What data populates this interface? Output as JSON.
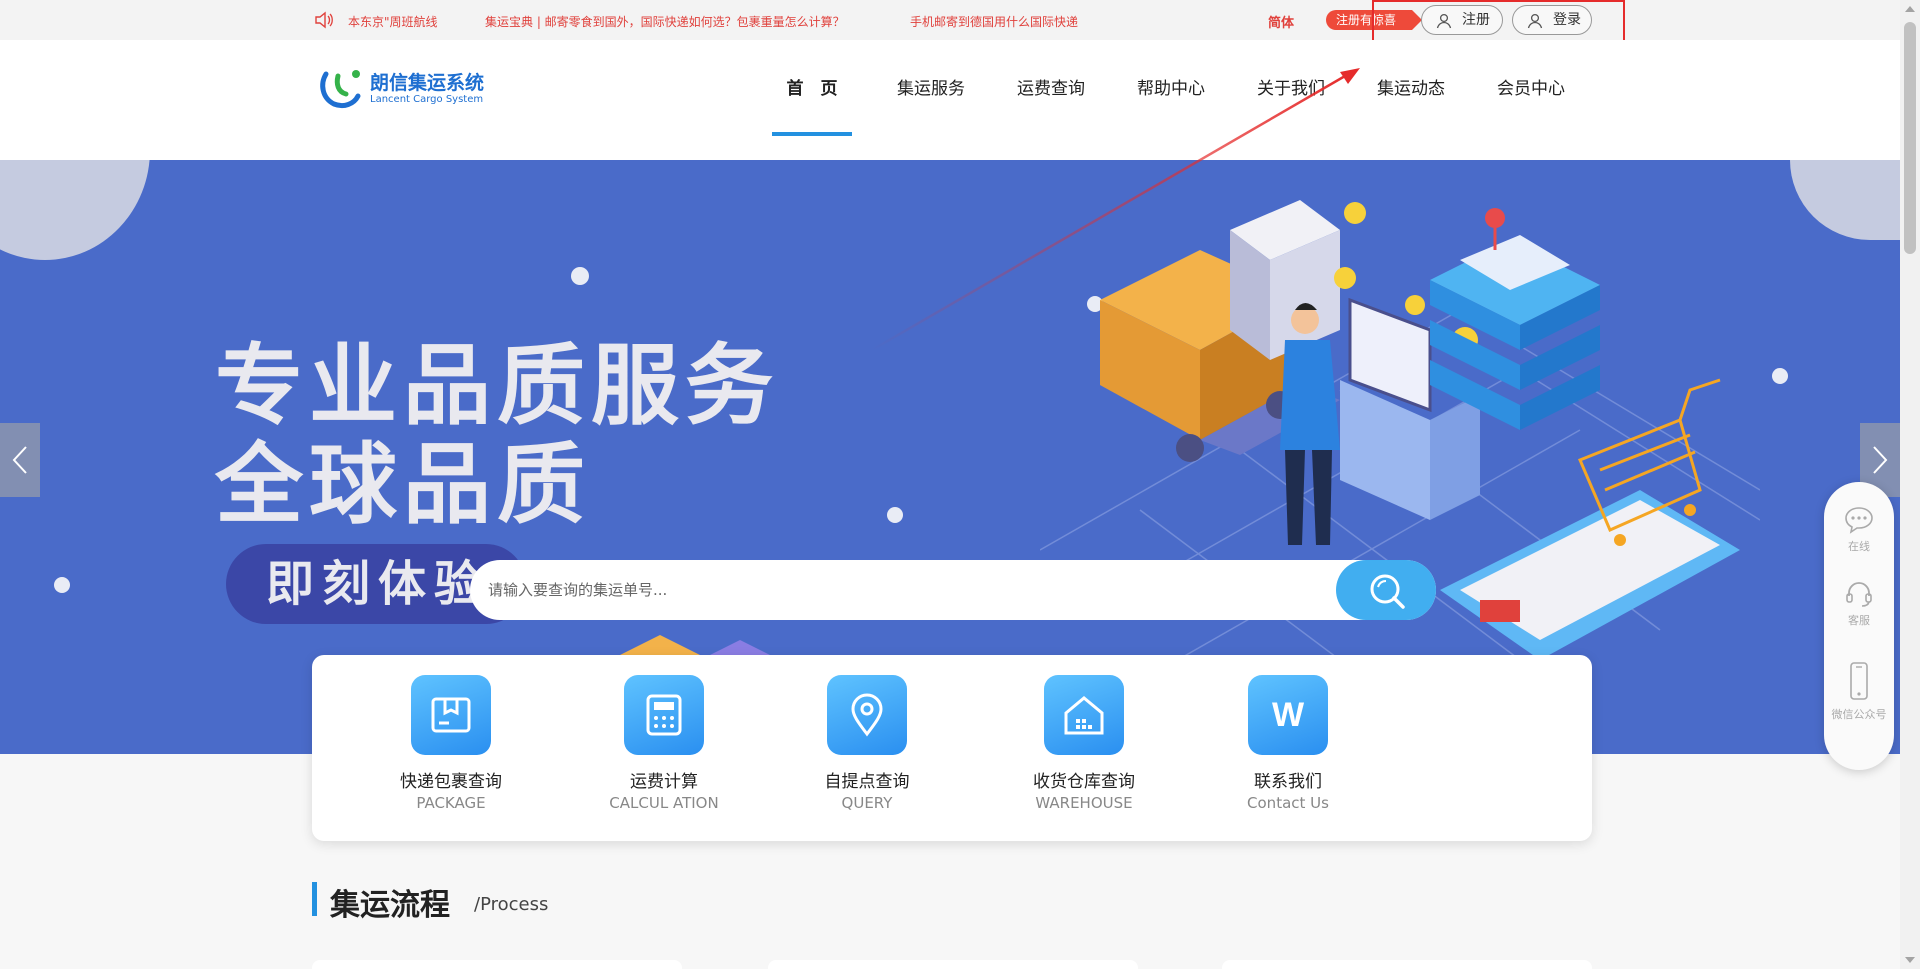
{
  "topbar": {
    "notices": [
      "本东京\"周班航线",
      "集运宝典 | 邮寄零食到国外，国际快递如何选？包裹重量怎么计算？",
      "手机邮寄到德国用什么国际快递"
    ],
    "language": "简体",
    "promo": "注册有惊喜",
    "register_label": "注册",
    "login_label": "登录"
  },
  "logo": {
    "name": "朗信集运系统",
    "sub": "Lancent Cargo System"
  },
  "nav": {
    "items": [
      "首　页",
      "集运服务",
      "运费查询",
      "帮助中心",
      "关于我们",
      "集运动态",
      "会员中心"
    ]
  },
  "banner": {
    "line1": "专业品质服务",
    "line2": "全球品质",
    "cta": "即刻体验"
  },
  "search": {
    "placeholder": "请输入要查询的集运单号..."
  },
  "services": [
    {
      "title": "快递包裹查询",
      "en": "PACKAGE",
      "icon": "package-icon"
    },
    {
      "title": "运费计算",
      "en": "CALCUL ATION",
      "icon": "calculator-icon"
    },
    {
      "title": "自提点查询",
      "en": "QUERY",
      "icon": "location-pin-icon"
    },
    {
      "title": "收货仓库查询",
      "en": "WAREHOUSE",
      "icon": "warehouse-icon"
    },
    {
      "title": "联系我们",
      "en": "Contact Us",
      "icon": "contact-w-icon"
    }
  ],
  "section": {
    "title": "集运流程",
    "subtitle": "/Process"
  },
  "float_panel": {
    "online": "在线",
    "service": "客服",
    "wechat": "微信公众号"
  },
  "colors": {
    "accent": "#2391e0",
    "banner_bg": "#4a6bc9",
    "notice_red": "#e0413c",
    "icon_blue": "#41aef0"
  }
}
